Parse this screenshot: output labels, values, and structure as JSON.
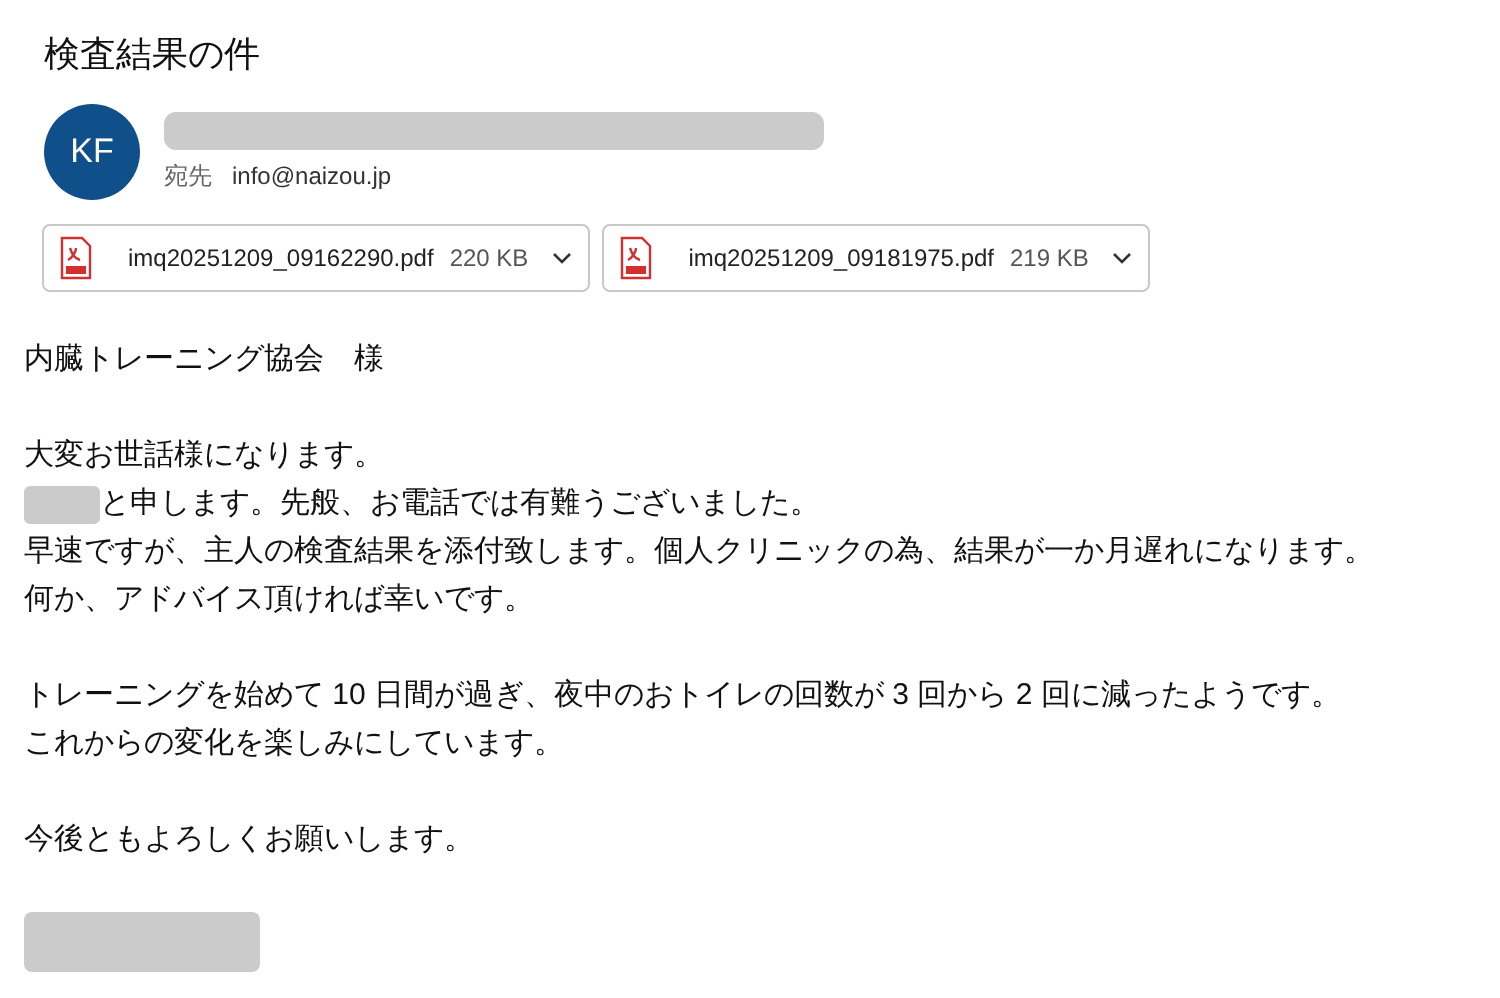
{
  "subject": "検査結果の件",
  "sender": {
    "initials": "KF",
    "name_redacted": true,
    "to_label": "宛先",
    "to": "info@naizou.jp"
  },
  "attachments": [
    {
      "name": "imq20251209_09162290.pdf",
      "size": "220 KB"
    },
    {
      "name": "imq20251209_09181975.pdf",
      "size": "219 KB"
    }
  ],
  "body": [
    {
      "lines": [
        {
          "text": "内臓トレーニング協会　様",
          "redacted_prefix": false
        }
      ]
    },
    {
      "lines": [
        {
          "text": "大変お世話様になります。",
          "redacted_prefix": false
        },
        {
          "text": "と申します。先般、お電話では有難うございました。",
          "redacted_prefix": true
        },
        {
          "text": "早速ですが、主人の検査結果を添付致します。個人クリニックの為、結果が一か月遅れになります。",
          "redacted_prefix": false
        },
        {
          "text": "何か、アドバイス頂ければ幸いです。",
          "redacted_prefix": false
        }
      ]
    },
    {
      "lines": [
        {
          "text": "トレーニングを始めて 10 日間が過ぎ、夜中のおトイレの回数が 3 回から 2 回に減ったようです。",
          "redacted_prefix": false
        },
        {
          "text": "これからの変化を楽しみにしています。",
          "redacted_prefix": false
        }
      ]
    },
    {
      "lines": [
        {
          "text": "今後ともよろしくお願いします。",
          "redacted_prefix": false
        }
      ]
    }
  ],
  "signature_redacted": true
}
